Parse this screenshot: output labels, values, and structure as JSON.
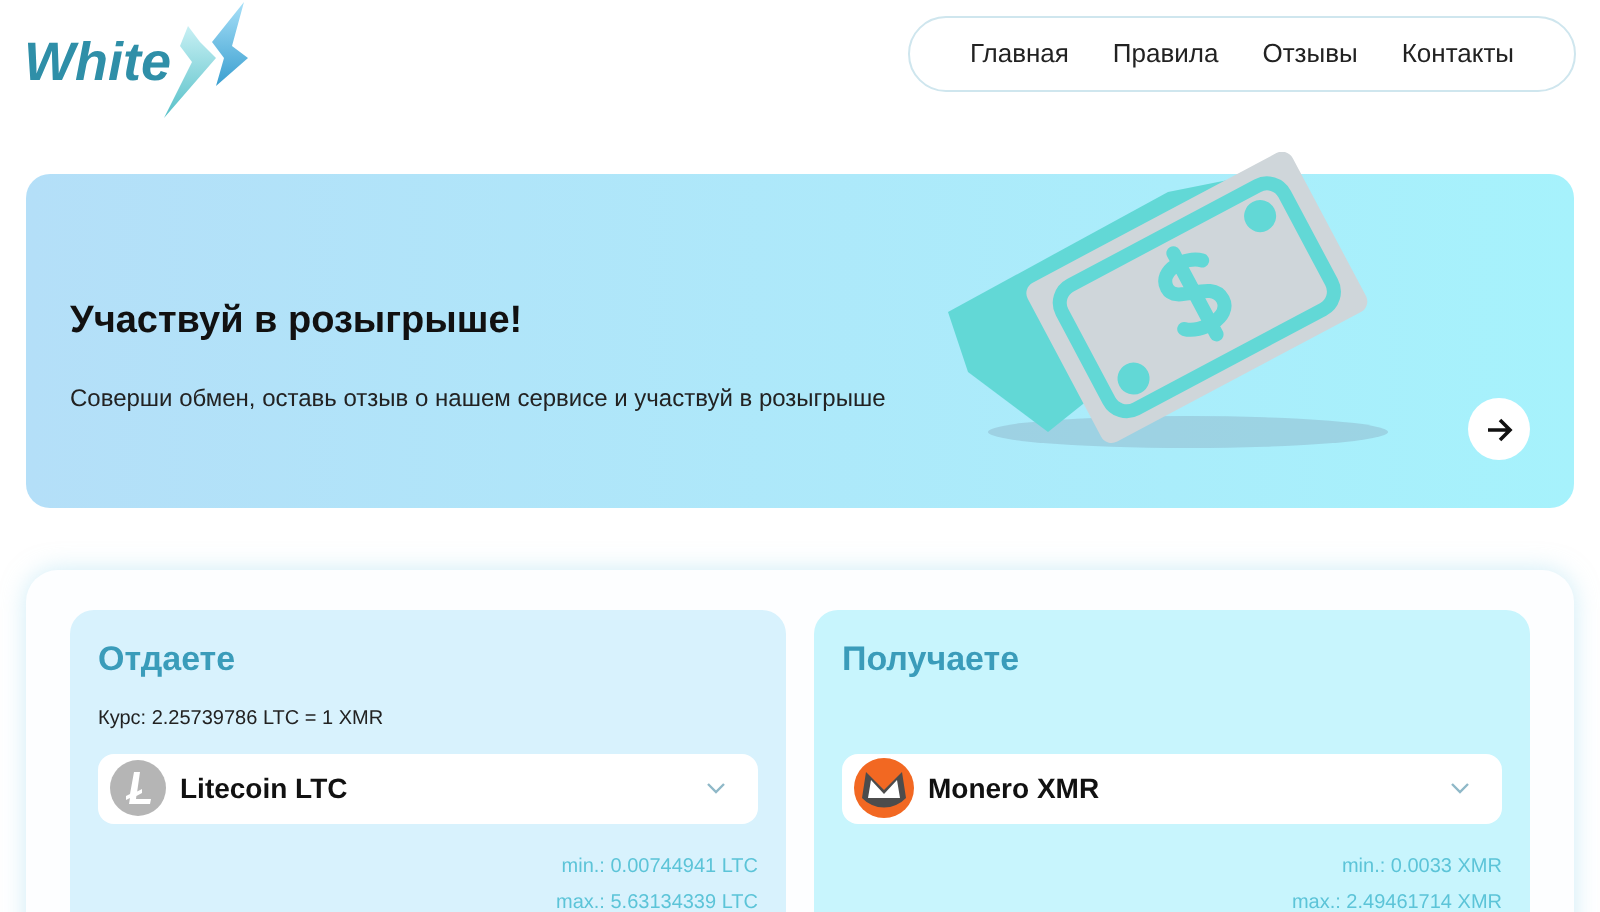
{
  "logo": {
    "text": "White"
  },
  "nav": [
    {
      "label": "Главная"
    },
    {
      "label": "Правила"
    },
    {
      "label": "Отзывы"
    },
    {
      "label": "Контакты"
    }
  ],
  "banner": {
    "title": "Участвуй в розыгрыше!",
    "subtitle": "Соверши обмен, оставь отзыв о нашем сервисе и участвуй в розыгрыше"
  },
  "exchange": [
    {
      "kind": "give",
      "title": "Отдаете",
      "rate": "Курс: 2.25739786 LTC = 1 XMR",
      "currency": "Litecoin LTC",
      "min": "min.: 0.00744941 LTC",
      "max": "max.: 5.63134339 LTC"
    },
    {
      "kind": "receive",
      "title": "Получаете",
      "currency": "Monero XMR",
      "min": "min.: 0.0033 XMR",
      "max": "max.: 2.49461714 XMR"
    }
  ]
}
